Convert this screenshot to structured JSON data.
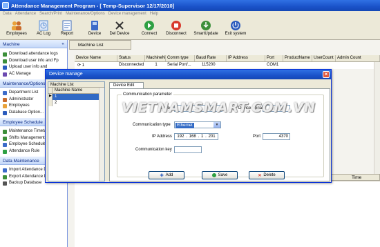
{
  "app": {
    "title": "Attendance Management Program - [ Temp-Supervisor 12/17/2010]"
  },
  "menu": [
    "Data",
    "Attendance",
    "Search/Print",
    "Maintenance/Options",
    "Device management",
    "Help"
  ],
  "toolbar": [
    {
      "label": "Employees",
      "icon": "employees-icon",
      "color": "#e9a23b"
    },
    {
      "label": "AC Log",
      "icon": "ac-log-icon",
      "color": "#5a8fd6"
    },
    {
      "label": "Report",
      "icon": "report-icon",
      "color": "#3f6fc2"
    },
    {
      "label": "Device",
      "icon": "device-icon",
      "color": "#3b6bc9"
    },
    {
      "label": "Del Device",
      "icon": "del-device-icon",
      "color": "#333333"
    },
    {
      "label": "Connect",
      "icon": "connect-icon",
      "color": "#2ea043"
    },
    {
      "label": "Disconnect",
      "icon": "disconnect-icon",
      "color": "#d83a2d"
    },
    {
      "label": "SmartUpdate",
      "icon": "smartupdate-icon",
      "color": "#3c8f3a"
    },
    {
      "label": "Exit system",
      "icon": "exit-icon",
      "color": "#2a5bbd"
    }
  ],
  "sidebar": {
    "machine": {
      "title": "Machine",
      "items": [
        "Download attendance logs",
        "Download user info and Fp",
        "Upload user info and",
        "AC Manage"
      ]
    },
    "maintenance": {
      "title": "Maintenance/Options",
      "items": [
        "Department List",
        "Administrator",
        "Employees",
        "Database Option..."
      ]
    },
    "schedule": {
      "title": "Employee Schedule",
      "items": [
        "Maintenance Timeta",
        "Shifts Management",
        "Employee Schedule",
        "Attendance Rule"
      ]
    },
    "data": {
      "title": "Data Maintenance",
      "items": [
        "Import Attendance D",
        "Export Attendance D",
        "Backup Database"
      ]
    }
  },
  "main": {
    "tab_label": "Machine List",
    "columns": [
      "Device Name",
      "Status",
      "MachineNo.",
      "Comm type",
      "Baud Rate",
      "IP Address",
      "Port",
      "ProductName",
      "UserCount",
      "Admin Count"
    ],
    "row": {
      "name": "1",
      "status": "Disconnected",
      "machine_no": "1",
      "comm_type": "Serial Port/...",
      "baud_rate": "115200",
      "ip": "",
      "port": "COM1"
    },
    "time_header": "Time"
  },
  "dialog": {
    "title": "Device manage",
    "list_title": "Machine List",
    "list_column": "Machine Name",
    "machines": [
      "1",
      "2"
    ],
    "tab": "Device Edit",
    "group_title": "Communication parameter",
    "name_label": "Name",
    "device_serial_label": "Device Serial",
    "comm_type_label": "Communication type",
    "comm_type_value": "Ethernet",
    "ip_label": "IP Address",
    "ip_parts": [
      "192",
      "168",
      "1",
      "201"
    ],
    "port_label": "Port",
    "port_value": "4370",
    "key_label": "Communication key",
    "buttons": {
      "add": "Add",
      "save": "Save",
      "delete": "Delete"
    }
  },
  "watermark": "VIETNAMSMART.COM.VN"
}
